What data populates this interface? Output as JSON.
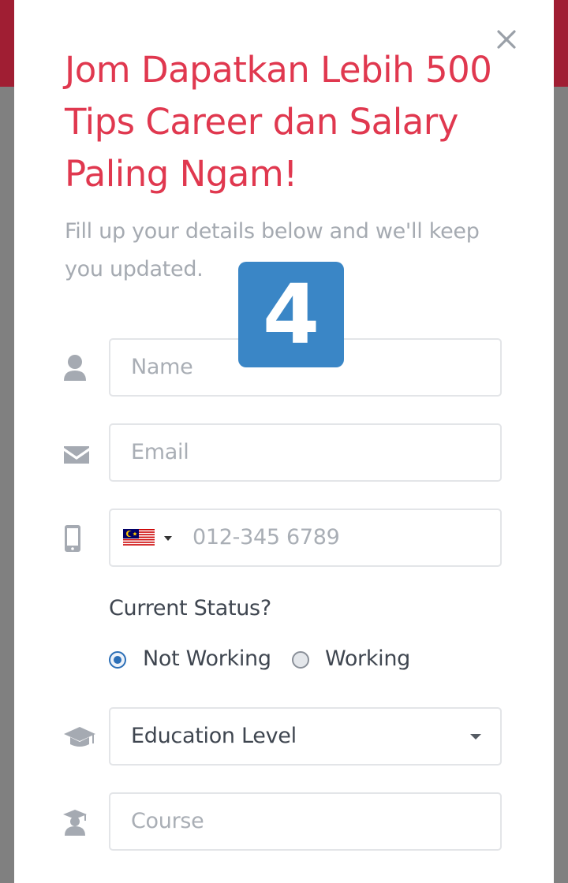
{
  "modal": {
    "title": "Jom Dapatkan Lebih 500 Tips Career dan Salary Paling Ngam!",
    "subtitle": "Fill up your details below and we'll keep you updated.",
    "badge": "4"
  },
  "form": {
    "name": {
      "placeholder": "Name",
      "icon": "user-icon"
    },
    "email": {
      "placeholder": "Email",
      "icon": "envelope-icon"
    },
    "phone": {
      "placeholder": "012-345 6789",
      "icon": "mobile-phone-icon",
      "country_flag": "malaysia-flag-icon"
    },
    "status": {
      "label": "Current Status?",
      "options": [
        {
          "label": "Not Working",
          "selected": true
        },
        {
          "label": "Working",
          "selected": false
        }
      ]
    },
    "education": {
      "value": "Education Level",
      "icon": "graduation-cap-icon"
    },
    "course": {
      "placeholder": "Course",
      "icon": "graduate-icon"
    }
  },
  "colors": {
    "title": "#e0384f",
    "top_bar": "#a01e33",
    "badge": "#3a86c6",
    "radio_selected": "#2c6fb7",
    "placeholder": "#a9aeb5",
    "icon": "#a5aab2"
  }
}
